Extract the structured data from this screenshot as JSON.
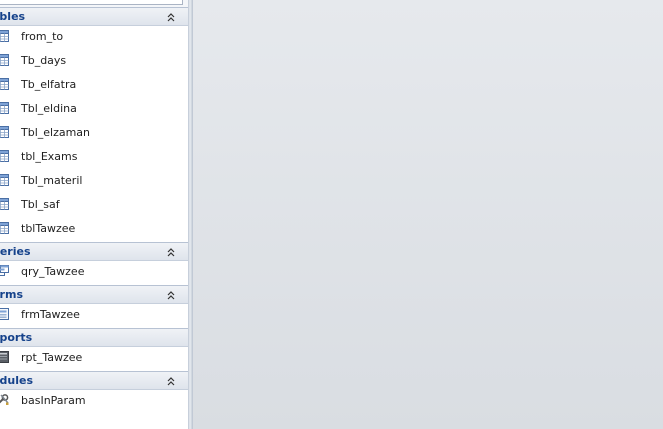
{
  "navigation_pane": {
    "groups": [
      {
        "title": "ables",
        "icon": "table-icon",
        "items": [
          {
            "label": "from_to"
          },
          {
            "label": "Tb_days"
          },
          {
            "label": "Tb_elfatra"
          },
          {
            "label": "Tbl_eldina"
          },
          {
            "label": "Tbl_elzaman"
          },
          {
            "label": "tbl_Exams"
          },
          {
            "label": "Tbl_materil"
          },
          {
            "label": "Tbl_saf"
          },
          {
            "label": "tblTawzee"
          }
        ]
      },
      {
        "title": "ueries",
        "icon": "query-icon",
        "items": [
          {
            "label": "qry_Tawzee"
          }
        ]
      },
      {
        "title": "orms",
        "icon": "form-icon",
        "items": [
          {
            "label": "frmTawzee"
          }
        ]
      },
      {
        "title": "eports",
        "icon": "report-icon",
        "items": [
          {
            "label": "rpt_Tawzee"
          }
        ]
      },
      {
        "title": "odules",
        "icon": "module-icon",
        "items": [
          {
            "label": "basInParam"
          }
        ]
      }
    ]
  },
  "colors": {
    "group_title": "#15428b",
    "workspace": "#dfe2e6"
  }
}
